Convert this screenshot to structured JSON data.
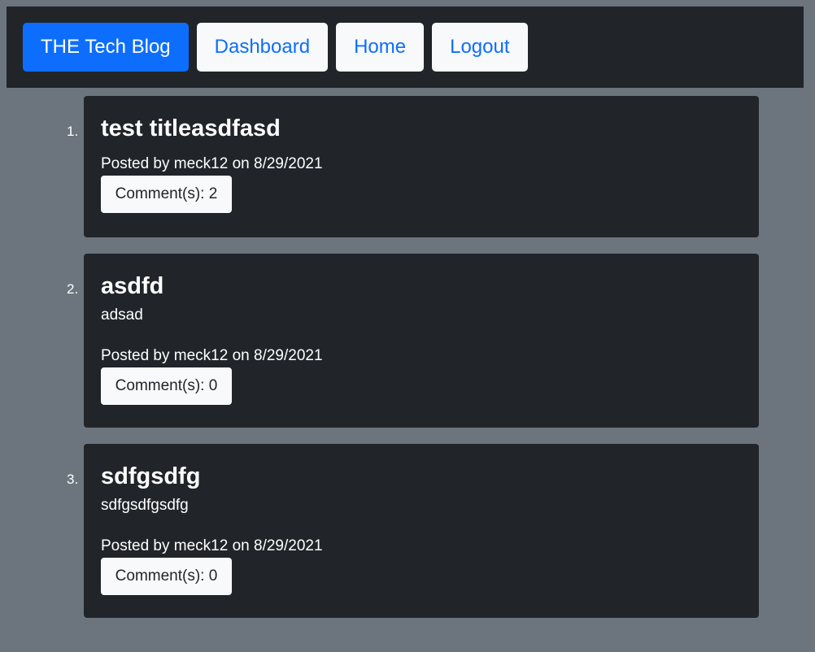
{
  "nav": {
    "brand": "THE Tech Blog",
    "dashboard": "Dashboard",
    "home": "Home",
    "logout": "Logout"
  },
  "posts": [
    {
      "number": "1.",
      "title": "test titleasdfasd",
      "body": "",
      "meta": "Posted by meck12 on 8/29/2021",
      "comments": "Comment(s): 2"
    },
    {
      "number": "2.",
      "title": "asdfd",
      "body": "adsad",
      "meta": "Posted by meck12 on 8/29/2021",
      "comments": "Comment(s): 0"
    },
    {
      "number": "3.",
      "title": "sdfgsdfg",
      "body": "sdfgsdfgsdfg",
      "meta": "Posted by meck12 on 8/29/2021",
      "comments": "Comment(s): 0"
    }
  ],
  "colors": {
    "page_background": "#6c757d",
    "panel": "#212529",
    "primary": "#0d6efd",
    "light": "#f8f9fa"
  }
}
